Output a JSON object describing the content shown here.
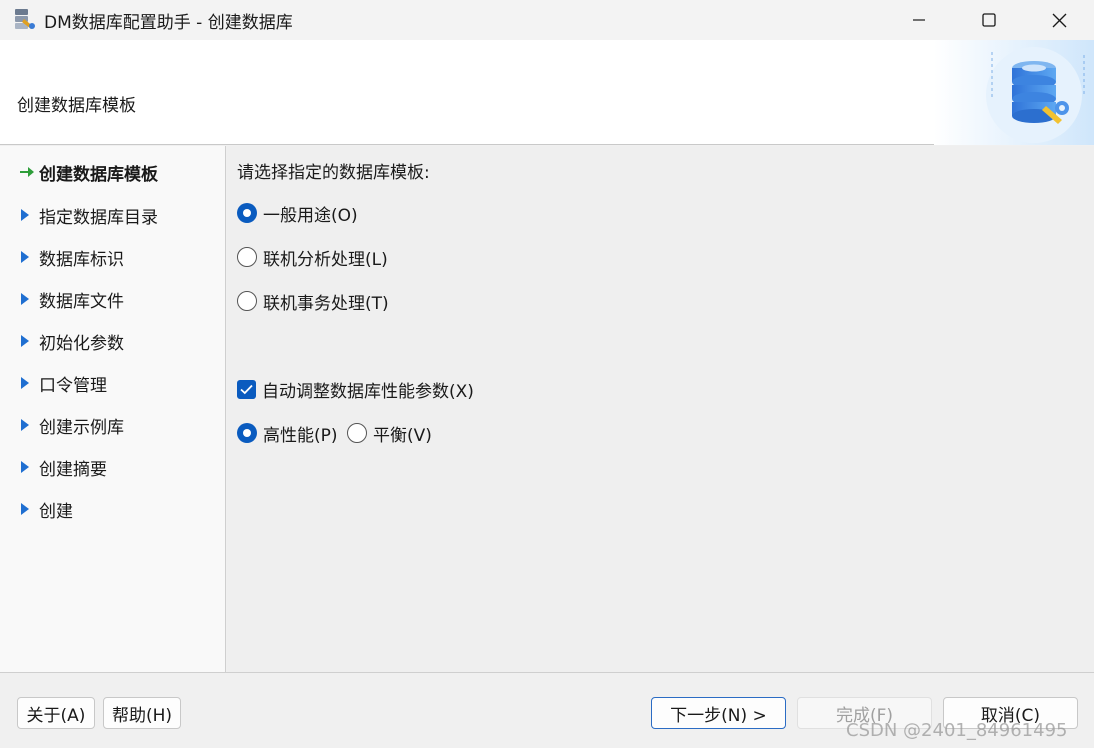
{
  "window": {
    "title": "DM数据库配置助手 - 创建数据库"
  },
  "header": {
    "title": "创建数据库模板",
    "graphic": "database-settings-icon"
  },
  "sidebar": {
    "items": [
      {
        "label": "创建数据库模板",
        "active": true
      },
      {
        "label": "指定数据库目录",
        "active": false
      },
      {
        "label": "数据库标识",
        "active": false
      },
      {
        "label": "数据库文件",
        "active": false
      },
      {
        "label": "初始化参数",
        "active": false
      },
      {
        "label": "口令管理",
        "active": false
      },
      {
        "label": "创建示例库",
        "active": false
      },
      {
        "label": "创建摘要",
        "active": false
      },
      {
        "label": "创建",
        "active": false
      }
    ]
  },
  "main": {
    "prompt": "请选择指定的数据库模板:",
    "templates": [
      {
        "label": "一般用途(O)",
        "checked": true
      },
      {
        "label": "联机分析处理(L)",
        "checked": false
      },
      {
        "label": "联机事务处理(T)",
        "checked": false
      }
    ],
    "auto_tune": {
      "label": "自动调整数据库性能参数(X)",
      "checked": true
    },
    "performance": [
      {
        "label": "高性能(P)",
        "checked": true
      },
      {
        "label": "平衡(V)",
        "checked": false
      }
    ]
  },
  "footer": {
    "about": "关于(A)",
    "help": "帮助(H)",
    "next": "下一步(N) >",
    "finish": "完成(F)",
    "cancel": "取消(C)"
  },
  "watermark": "CSDN @2401_84961495",
  "colors": {
    "accent": "#0a5bbf",
    "active_arrow": "#2e9e3a",
    "step_arrow": "#1f6fd1"
  }
}
